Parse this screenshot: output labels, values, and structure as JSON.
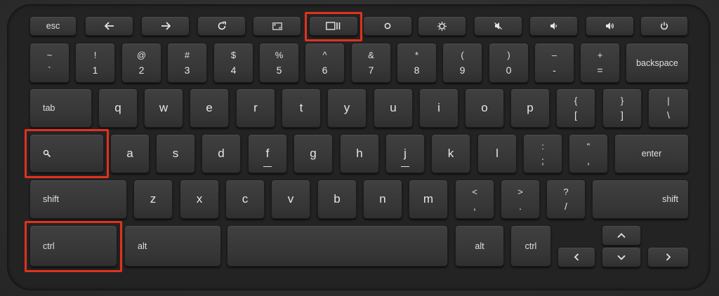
{
  "keyboard": {
    "row_fn": {
      "esc": "esc",
      "icons": [
        "back-arrow",
        "forward-arrow",
        "refresh",
        "fullscreen",
        "overview",
        "brightness-down",
        "brightness-up",
        "mute",
        "volume-down",
        "volume-up",
        "power"
      ]
    },
    "row_num": {
      "keys": [
        {
          "top": "~",
          "bottom": "`"
        },
        {
          "top": "!",
          "bottom": "1"
        },
        {
          "top": "@",
          "bottom": "2"
        },
        {
          "top": "#",
          "bottom": "3"
        },
        {
          "top": "$",
          "bottom": "4"
        },
        {
          "top": "%",
          "bottom": "5"
        },
        {
          "top": "^",
          "bottom": "6"
        },
        {
          "top": "&",
          "bottom": "7"
        },
        {
          "top": "*",
          "bottom": "8"
        },
        {
          "top": "(",
          "bottom": "9"
        },
        {
          "top": ")",
          "bottom": "0"
        },
        {
          "top": "–",
          "bottom": "-"
        },
        {
          "top": "+",
          "bottom": "="
        }
      ],
      "backspace": "backspace"
    },
    "row_q": {
      "tab": "tab",
      "letters": [
        "q",
        "w",
        "e",
        "r",
        "t",
        "y",
        "u",
        "i",
        "o",
        "p"
      ],
      "brackets": [
        {
          "top": "{",
          "bottom": "["
        },
        {
          "top": "}",
          "bottom": "]"
        },
        {
          "top": "|",
          "bottom": "\\"
        }
      ]
    },
    "row_a": {
      "letters": [
        "a",
        "s",
        "d",
        "f",
        "g",
        "h",
        "j",
        "k",
        "l"
      ],
      "punct": [
        {
          "top": ":",
          "bottom": ";"
        },
        {
          "top": "“",
          "bottom": ","
        }
      ],
      "enter": "enter"
    },
    "row_z": {
      "shift_left": "shift",
      "letters": [
        "z",
        "x",
        "c",
        "v",
        "b",
        "n",
        "m"
      ],
      "punct": [
        {
          "top": "<",
          "bottom": ","
        },
        {
          "top": ">",
          "bottom": "."
        },
        {
          "top": "?",
          "bottom": "/"
        }
      ],
      "shift_right": "shift"
    },
    "row_bottom": {
      "ctrl_left": "ctrl",
      "alt_left": "alt",
      "alt_right": "alt",
      "ctrl_right": "ctrl",
      "arrows": [
        "left",
        "up",
        "down",
        "right"
      ]
    },
    "highlight_color": "#e0321e",
    "highlighted_keys": [
      "overview-key",
      "search-key",
      "ctrl-left-key"
    ]
  }
}
